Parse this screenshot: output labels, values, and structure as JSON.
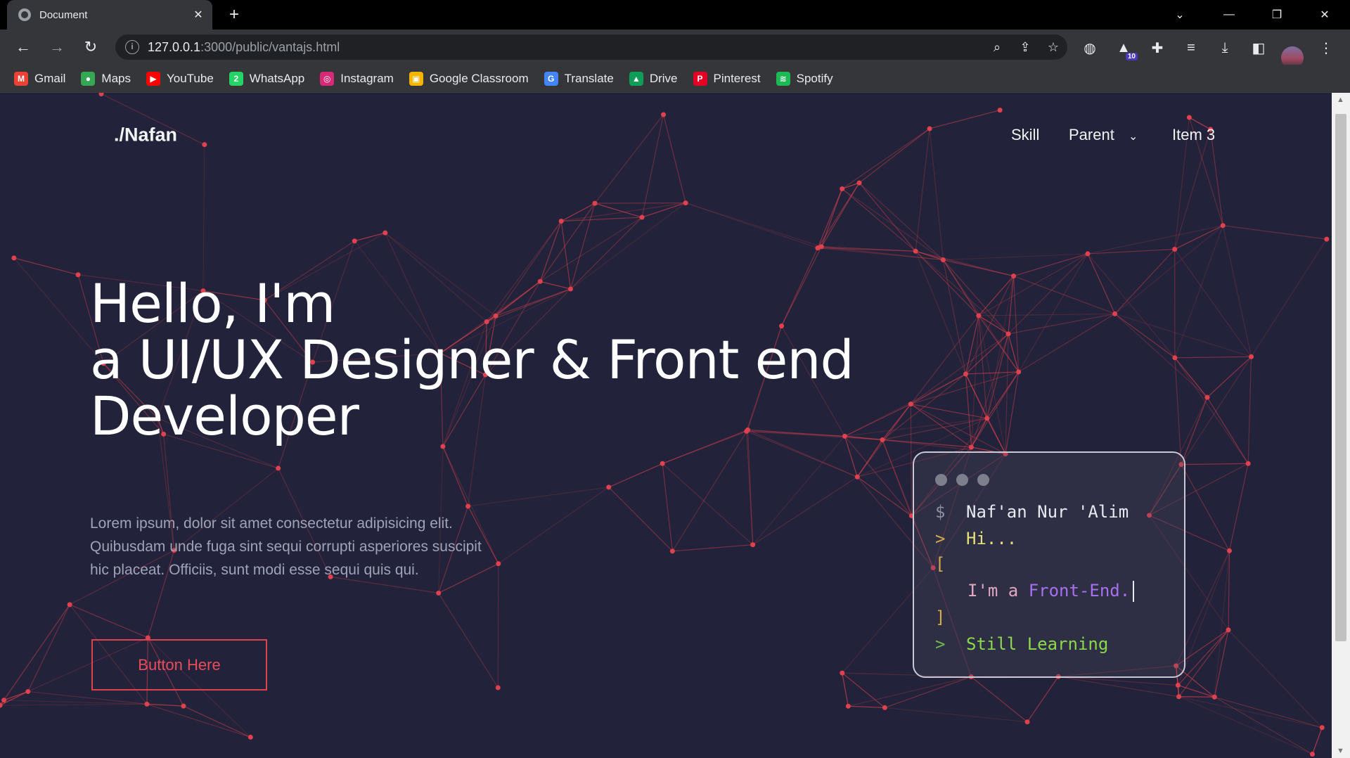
{
  "browser": {
    "tab_title": "Document",
    "url_host": "127.0.0.1",
    "url_rest": ":3000/public/vantajs.html",
    "extension_badge": "10",
    "bookmarks": [
      {
        "label": "Gmail",
        "icon": "gmail-icon",
        "color": "#ea4335",
        "glyph": "M"
      },
      {
        "label": "Maps",
        "icon": "maps-icon",
        "color": "#34a853",
        "glyph": "●"
      },
      {
        "label": "YouTube",
        "icon": "youtube-icon",
        "color": "#ff0000",
        "glyph": "▶"
      },
      {
        "label": "WhatsApp",
        "icon": "whatsapp-icon",
        "color": "#25d366",
        "glyph": "2"
      },
      {
        "label": "Instagram",
        "icon": "instagram-icon",
        "color": "#d62976",
        "glyph": "◎"
      },
      {
        "label": "Google Classroom",
        "icon": "classroom-icon",
        "color": "#f4b400",
        "glyph": "▣"
      },
      {
        "label": "Translate",
        "icon": "translate-icon",
        "color": "#4285f4",
        "glyph": "G"
      },
      {
        "label": "Drive",
        "icon": "drive-icon",
        "color": "#0f9d58",
        "glyph": "▲"
      },
      {
        "label": "Pinterest",
        "icon": "pinterest-icon",
        "color": "#e60023",
        "glyph": "P"
      },
      {
        "label": "Spotify",
        "icon": "spotify-icon",
        "color": "#1db954",
        "glyph": "≋"
      }
    ]
  },
  "page": {
    "logo": "./Nafan",
    "nav": {
      "item1": "Skill",
      "item2": "Parent",
      "item3": "Item 3"
    },
    "hero": {
      "line1": "Hello, I'm",
      "line2": "a UI/UX Designer & Front end",
      "line3": "Developer",
      "description": "Lorem ipsum, dolor sit amet consectetur adipisicing elit. Quibusdam unde fuga sint sequi corrupti asperiores suscipit hic placeat. Officiis, sunt modi esse sequi quis qui.",
      "button": "Button Here"
    },
    "terminal": {
      "prompt_symbol": "$",
      "name": "Naf'an Nur 'Alim",
      "arrow": ">",
      "greeting": "Hi...",
      "bracket_open": "[",
      "role_prefix": "I'm a ",
      "role": "Front-End.",
      "bracket_close": "]",
      "status": "Still Learning"
    },
    "colors": {
      "background": "#22233a",
      "accent": "#e0414f",
      "network_line": "#e0414f"
    }
  }
}
